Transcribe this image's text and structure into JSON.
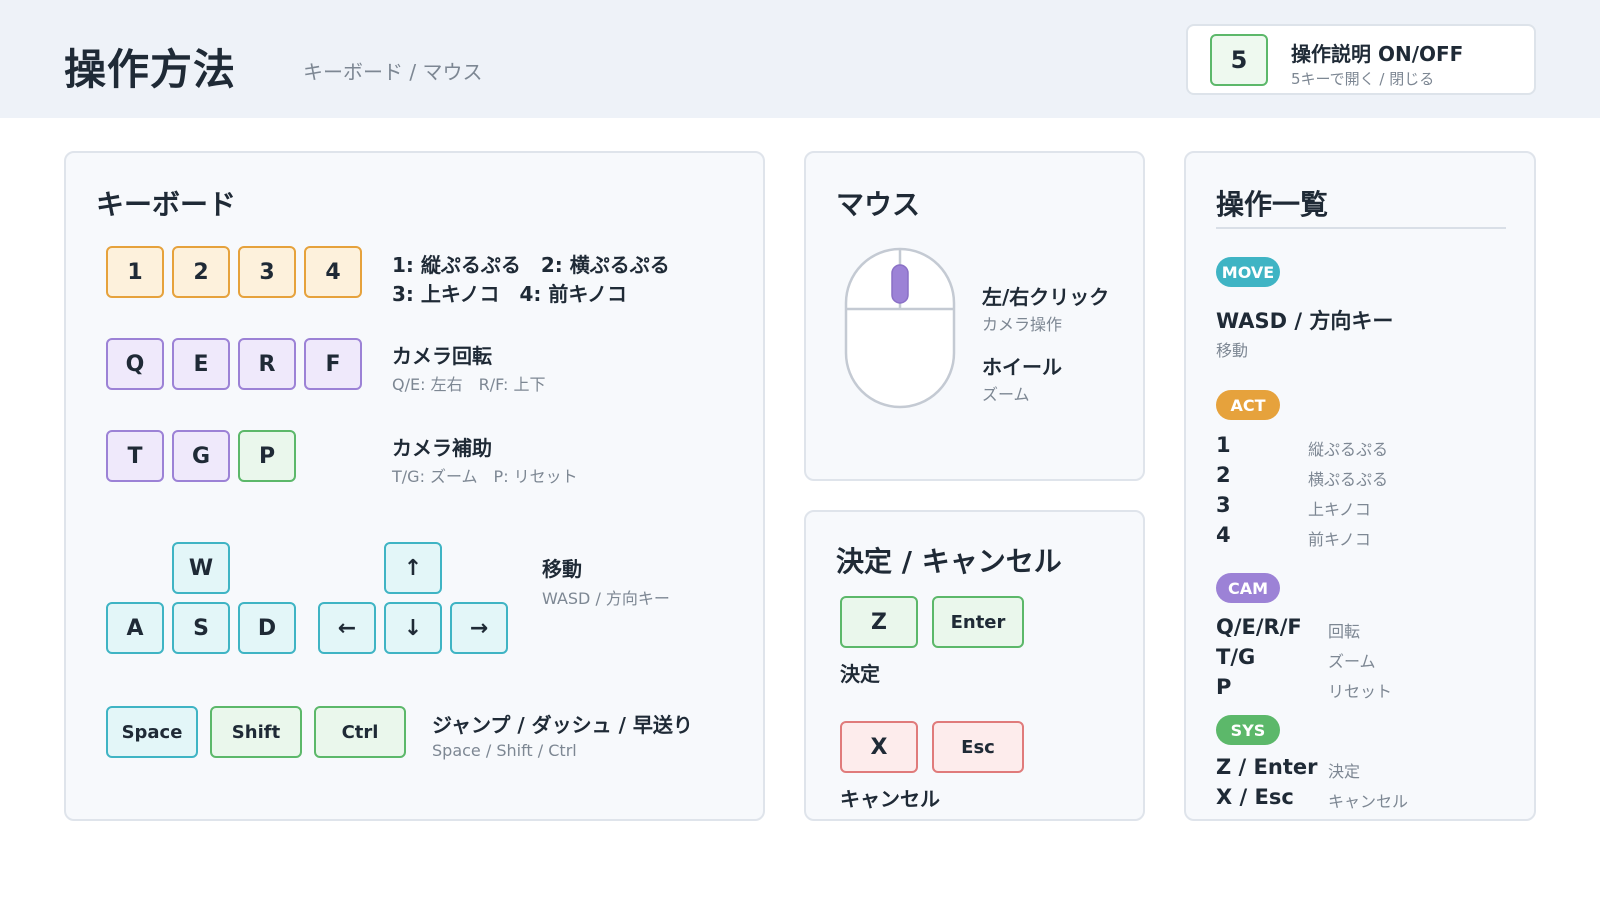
{
  "header": {
    "title": "操作方法",
    "subtitle": "キーボード / マウス",
    "toggle": {
      "key": "5",
      "title": "操作説明 ON/OFF",
      "desc": "5キーで開く / 閉じる"
    }
  },
  "keyboard": {
    "title": "キーボード",
    "number_keys": [
      "1",
      "2",
      "3",
      "4"
    ],
    "number_desc_line1": "1: 縦ぷるぷる　2: 横ぷるぷる",
    "number_desc_line2": "3: 上キノコ　4: 前キノコ",
    "camera_keys": [
      "Q",
      "E",
      "R",
      "F"
    ],
    "camera_label": "カメラ回転",
    "camera_desc": "Q/E: 左右　R/F: 上下",
    "assist_keys": [
      "T",
      "G",
      "P"
    ],
    "assist_label": "カメラ補助",
    "assist_desc": "T/G: ズーム　P: リセット",
    "move_keys": {
      "w": "W",
      "a": "A",
      "s": "S",
      "d": "D",
      "up": "↑",
      "left": "←",
      "down": "↓",
      "right": "→"
    },
    "move_label": "移動",
    "move_desc": "WASD / 方向キー",
    "action_keys": [
      "Space",
      "Shift",
      "Ctrl"
    ],
    "action_label": "ジャンプ / ダッシュ / 早送り",
    "action_desc": "Space / Shift / Ctrl"
  },
  "mouse": {
    "title": "マウス",
    "click_label": "左/右クリック",
    "click_desc": "カメラ操作",
    "wheel_label": "ホイール",
    "wheel_desc": "ズーム"
  },
  "decide": {
    "title": "決定 / キャンセル",
    "confirm_keys": [
      "Z",
      "Enter"
    ],
    "confirm_label": "決定",
    "cancel_keys": [
      "X",
      "Esc"
    ],
    "cancel_label": "キャンセル"
  },
  "summary": {
    "title": "操作一覧",
    "move": {
      "badge": "MOVE",
      "key": "WASD / 方向キー",
      "desc": "移動"
    },
    "act": {
      "badge": "ACT",
      "rows": [
        {
          "key": "1",
          "desc": "縦ぷるぷる"
        },
        {
          "key": "2",
          "desc": "横ぷるぷる"
        },
        {
          "key": "3",
          "desc": "上キノコ"
        },
        {
          "key": "4",
          "desc": "前キノコ"
        }
      ]
    },
    "cam": {
      "badge": "CAM",
      "rows": [
        {
          "key": "Q/E/R/F",
          "desc": "回転"
        },
        {
          "key": "T/G",
          "desc": "ズーム"
        },
        {
          "key": "P",
          "desc": "リセット"
        }
      ]
    },
    "sys": {
      "badge": "SYS",
      "rows": [
        {
          "key": "Z / Enter",
          "desc": "決定"
        },
        {
          "key": "X / Esc",
          "desc": "キャンセル"
        }
      ]
    }
  },
  "colors": {
    "move": "#3fb4c4",
    "act": "#e6a23c",
    "cam": "#9c82d6",
    "sys": "#5cb86a"
  }
}
